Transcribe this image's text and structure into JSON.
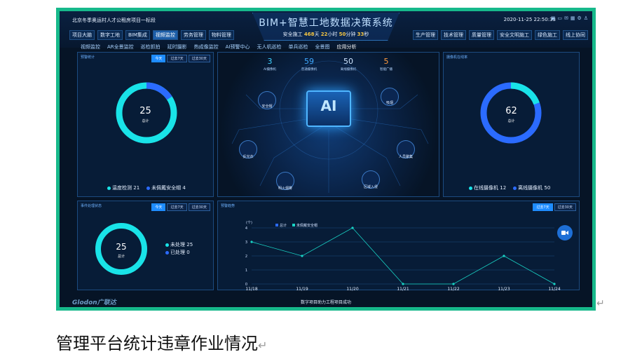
{
  "header": {
    "project": "北京冬季奥运村人才公租房项目一标段",
    "system_title": "BIM+智慧工地数据决策系统",
    "safety_prefix": "安全施工",
    "safety_days": "468",
    "safety_days_unit": "天",
    "safety_hours": "22",
    "safety_hours_unit": "小时",
    "safety_minutes": "50",
    "safety_minutes_unit": "分钟",
    "safety_seconds": "33",
    "safety_seconds_unit": "秒",
    "datetime": "2020-11-25 22:50:33"
  },
  "nav_left": [
    "项目大脑",
    "数字工地",
    "BIM集成",
    "视频监控",
    "劳务管理",
    "物料管理"
  ],
  "nav_right": [
    "生产管理",
    "技术管理",
    "质量管理",
    "安全文明施工",
    "绿色施工",
    "线上协同"
  ],
  "subnav": [
    "视频监控",
    "AR全景监控",
    "巡检抓拍",
    "延时摄影",
    "热成像监控",
    "AI预警中心",
    "无人机巡检",
    "单兵巡检",
    "全景图",
    "应用分析"
  ],
  "alarm_panel": {
    "title": "预警统计",
    "tabs": [
      "今天",
      "过去7天",
      "过去30天"
    ],
    "total": "25",
    "total_label": "总计",
    "legend": [
      {
        "label": "温度检测",
        "value": "21",
        "color": "#19e3e8"
      },
      {
        "label": "未佩戴安全帽",
        "value": "4",
        "color": "#2b6bff"
      }
    ]
  },
  "camera_panel": {
    "title": "摄像机在线率",
    "total": "62",
    "total_label": "总计",
    "legend": [
      {
        "label": "在线摄像机",
        "value": "12",
        "color": "#19e3e8"
      },
      {
        "label": "离线摄像机",
        "value": "50",
        "color": "#2b6bff"
      }
    ]
  },
  "event_panel": {
    "title": "事件处理状态",
    "tabs": [
      "今天",
      "过去7天",
      "过去30天"
    ],
    "total": "25",
    "total_label": "总计",
    "legend": [
      {
        "label": "未处理",
        "value": "25",
        "color": "#19e3e8"
      },
      {
        "label": "已处理",
        "value": "0",
        "color": "#2b6bff"
      }
    ]
  },
  "center_stats": [
    {
      "value": "3",
      "label": "AI摄像机",
      "color": "#3fd2ff"
    },
    {
      "value": "59",
      "label": "普通摄像机",
      "color": "#3fa9ff"
    },
    {
      "value": "50",
      "label": "离线摄像机",
      "color": "#cfe6ff"
    },
    {
      "value": "5",
      "label": "智能广播",
      "color": "#ff9b3f"
    }
  ],
  "center_nodes": [
    "安全帽",
    "吸烟",
    "反光衣",
    "人员聚集",
    "明火烟雾",
    "区域入侵"
  ],
  "chip_label": "AI",
  "trend_panel": {
    "title": "预警趋势",
    "tabs": [
      "过去7天",
      "过去30天"
    ]
  },
  "chart_data": {
    "type": "line",
    "categories": [
      "11/18",
      "11/19",
      "11/20",
      "11/21",
      "11/22",
      "11/23",
      "11/24"
    ],
    "series": [
      {
        "name": "总计",
        "values": [
          3,
          2,
          4,
          0,
          0,
          2,
          0
        ]
      },
      {
        "name": "未佩戴安全帽",
        "values": [
          0,
          0,
          0,
          0,
          0,
          0,
          0
        ]
      }
    ],
    "ylabel": "(个)",
    "ylim": [
      0,
      4
    ],
    "yticks": [
      "0",
      "1",
      "2",
      "3",
      "4"
    ],
    "grid": true,
    "legend": "top-left",
    "colors": [
      "#2b6bff",
      "#19d3c5"
    ]
  },
  "footer": {
    "logo": "Glodon广联达",
    "text": "数字项目助力工程项目成功"
  },
  "caption": "管理平台统计违章作业情况",
  "colors": {
    "frame": "#17b98b",
    "background": "#061426",
    "accent": "#1e8cff"
  }
}
